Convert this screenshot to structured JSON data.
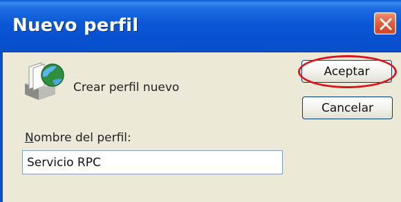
{
  "window": {
    "title": "Nuevo perfil"
  },
  "header": {
    "description": "Crear perfil nuevo"
  },
  "buttons": {
    "ok_label": "Aceptar",
    "cancel_label": "Cancelar"
  },
  "profile_name": {
    "label_first_letter": "N",
    "label_rest": "ombre del perfil:",
    "value": "Servicio RPC"
  },
  "icons": {
    "title_close": "close-icon",
    "profile": "mail-profile-icon"
  },
  "colors": {
    "titlebar": "#0a58d6",
    "client_background": "#ece9d8",
    "close_button": "#e2613f",
    "highlight_ring": "#d8161d"
  }
}
